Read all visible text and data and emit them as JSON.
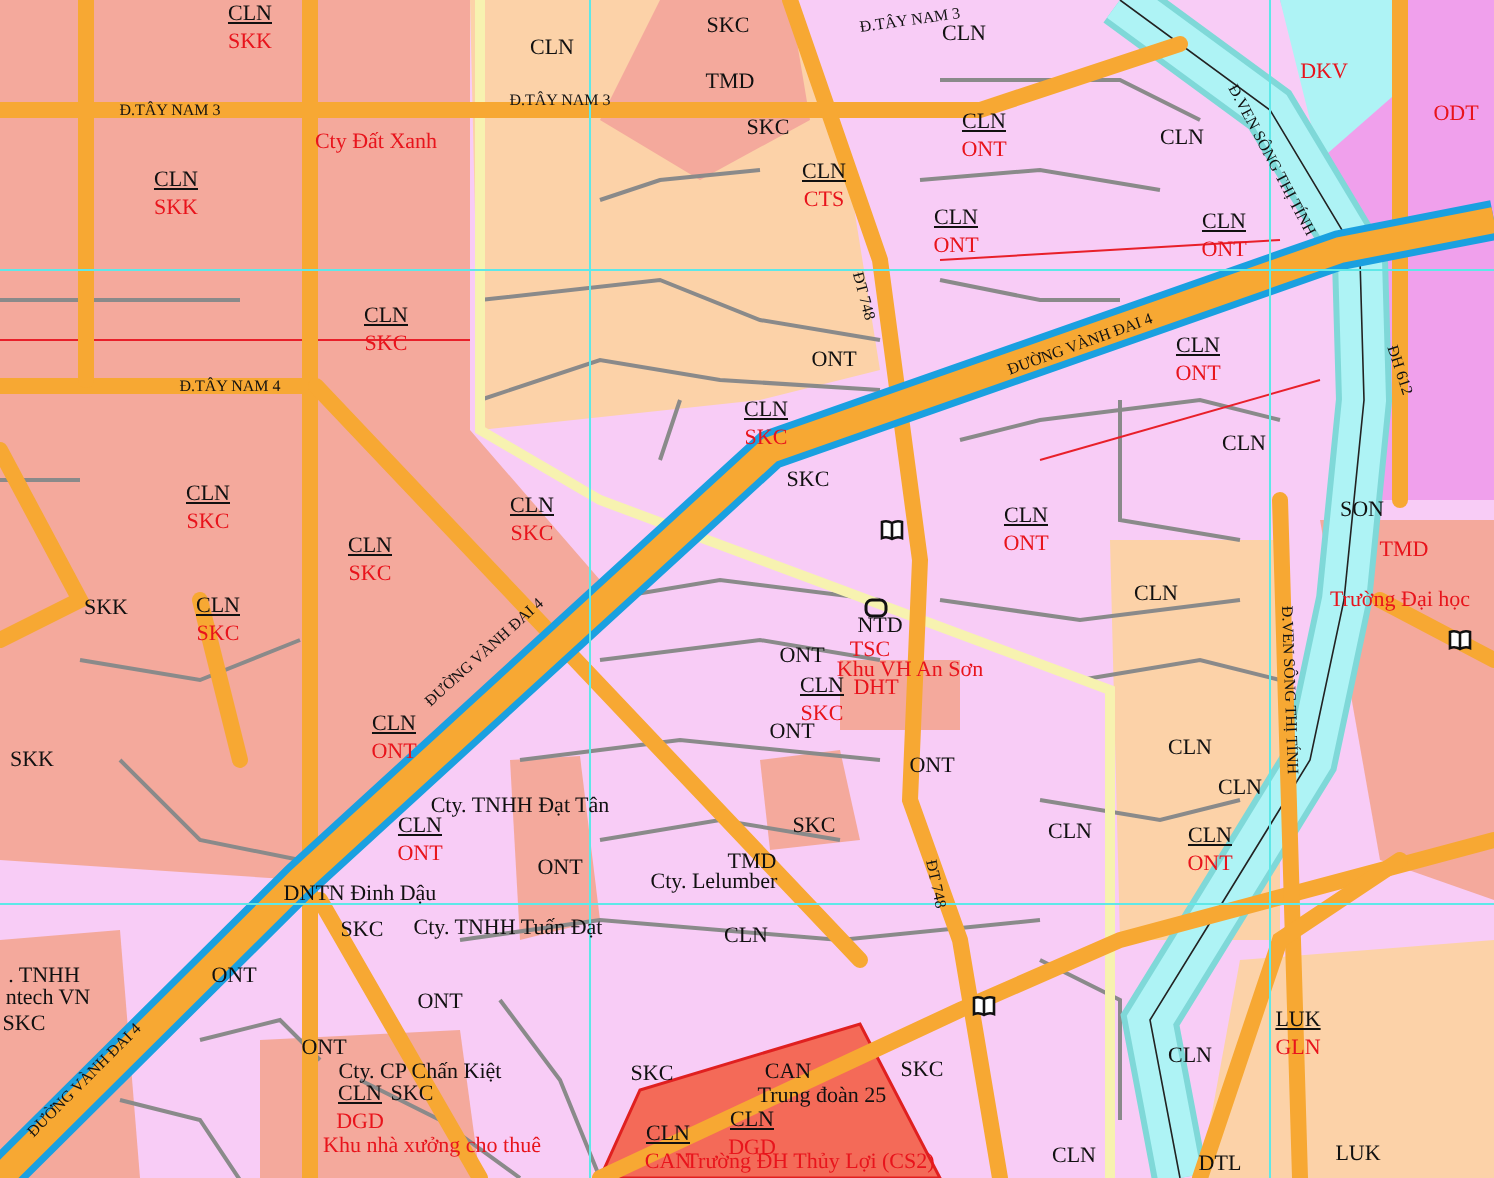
{
  "map": {
    "labels": [
      {
        "kind": "parcel",
        "top": "CLN",
        "bottom": "SKK"
      },
      {
        "kind": "parcel",
        "top": "CLN",
        "bottom": "SKK"
      },
      {
        "kind": "parcel",
        "top": "CLN",
        "bottom": "SKC"
      },
      {
        "kind": "parcel",
        "top": "CLN",
        "bottom": "SKC"
      },
      {
        "kind": "parcel",
        "top": "CLN",
        "bottom": "SKC"
      },
      {
        "kind": "parcel",
        "top": "CLN",
        "bottom": "SKC"
      },
      {
        "kind": "parcel",
        "top": "CLN",
        "bottom": "SKC"
      },
      {
        "kind": "parcel",
        "top": "CLN",
        "bottom": "CTS"
      },
      {
        "kind": "parcel",
        "top": "CLN",
        "bottom": "ONT"
      },
      {
        "kind": "parcel",
        "top": "CLN",
        "bottom": "ONT"
      },
      {
        "kind": "parcel",
        "top": "CLN",
        "bottom": "SKC"
      },
      {
        "kind": "parcel",
        "top": "CLN",
        "bottom": "ONT"
      },
      {
        "kind": "parcel",
        "top": "CLN",
        "bottom": "ONT"
      },
      {
        "kind": "parcel",
        "top": "CLN",
        "bottom": "ONT"
      },
      {
        "kind": "parcel",
        "top": "CLN",
        "bottom": "ONT"
      },
      {
        "kind": "parcel",
        "top": "CLN",
        "bottom": "ONT"
      },
      {
        "kind": "parcel",
        "top": "CLN",
        "bottom": "DGD"
      },
      {
        "kind": "parcel",
        "top": "CLN",
        "bottom": "SKC"
      },
      {
        "kind": "parcel",
        "top": "CLN",
        "bottom": "DGD"
      },
      {
        "kind": "parcel",
        "top": "CLN",
        "bottom": "CAN"
      },
      {
        "kind": "parcel",
        "top": "CLN",
        "bottom": "ONT"
      },
      {
        "kind": "parcel",
        "top": "LUK",
        "bottom": "GLN"
      },
      {
        "kind": "code",
        "text": "SKC"
      },
      {
        "kind": "code",
        "text": "CLN"
      },
      {
        "kind": "code",
        "text": "TMD"
      },
      {
        "kind": "code",
        "text": "SKC"
      },
      {
        "kind": "code",
        "text": "CLN"
      },
      {
        "kind": "code",
        "text": "CLN"
      },
      {
        "kind": "code",
        "text": "ONT"
      },
      {
        "kind": "code",
        "text": "SKC"
      },
      {
        "kind": "code",
        "text": "ONT"
      },
      {
        "kind": "code",
        "text": "ONT"
      },
      {
        "kind": "code",
        "text": "ONT"
      },
      {
        "kind": "code",
        "text": "SKC"
      },
      {
        "kind": "code",
        "text": "TMD"
      },
      {
        "kind": "code",
        "text": "SKC"
      },
      {
        "kind": "code",
        "text": "CLN"
      },
      {
        "kind": "code",
        "text": "ONT"
      },
      {
        "kind": "code",
        "text": "ONT"
      },
      {
        "kind": "code",
        "text": "ONT"
      },
      {
        "kind": "code",
        "text": "SKC"
      },
      {
        "kind": "code",
        "text": "SKC"
      },
      {
        "kind": "code",
        "text": "CAN"
      },
      {
        "kind": "code",
        "text": "SKC"
      },
      {
        "kind": "code",
        "text": "SKK"
      },
      {
        "kind": "code",
        "text": "SKK"
      },
      {
        "kind": "code",
        "text": "ONT"
      },
      {
        "kind": "code",
        "text": "CLN"
      },
      {
        "kind": "code",
        "text": "SON"
      },
      {
        "kind": "code",
        "text": "CLN"
      },
      {
        "kind": "code",
        "text": "CLN"
      },
      {
        "kind": "code",
        "text": "CLN"
      },
      {
        "kind": "code",
        "text": "CLN"
      },
      {
        "kind": "code",
        "text": "CLN"
      },
      {
        "kind": "code",
        "text": "CLN"
      },
      {
        "kind": "code",
        "text": "NTD"
      },
      {
        "kind": "code",
        "text": "SKC"
      },
      {
        "kind": "code",
        "text": "LUK"
      },
      {
        "kind": "code",
        "text": "DTL"
      },
      {
        "kind": "code_red",
        "text": "DKV"
      },
      {
        "kind": "code_red",
        "text": "ODT"
      },
      {
        "kind": "code_red",
        "text": "TMD"
      },
      {
        "kind": "code_red",
        "text": "TSC"
      },
      {
        "kind": "code_red",
        "text": "DHT"
      },
      {
        "kind": "label",
        "text": "Cty. TNHH Đạt Tân"
      },
      {
        "kind": "label",
        "text": "Cty. TNHH Tuấn Đạt"
      },
      {
        "kind": "label",
        "text": "Cty. Lelumber"
      },
      {
        "kind": "label",
        "text": "DNTN Đinh Dậu"
      },
      {
        "kind": "label",
        "text": "Cty. CP Chấn Kiệt"
      },
      {
        "kind": "label",
        "text": "Trung đoàn 25"
      },
      {
        "kind": "label",
        "text": ". TNHH"
      },
      {
        "kind": "label",
        "text": "ntech VN"
      },
      {
        "kind": "label_red",
        "text": "Cty Đất Xanh"
      },
      {
        "kind": "label_red",
        "text": "Khu VH An Sơn"
      },
      {
        "kind": "label_red",
        "text": "Khu nhà xưởng cho thuê"
      },
      {
        "kind": "label_red",
        "text": "Trường Đại học"
      },
      {
        "kind": "label_red",
        "text": "Trường ĐH Thủy Lợi (CS2)"
      },
      {
        "kind": "road",
        "text": "Đ.TÂY NAM 3"
      },
      {
        "kind": "road",
        "text": "Đ.TÂY NAM 3"
      },
      {
        "kind": "road",
        "text": "Đ.TÂY NAM 3"
      },
      {
        "kind": "road",
        "text": "Đ.TÂY NAM 4"
      },
      {
        "kind": "road",
        "text": "ĐƯỜNG VÀNH ĐAI 4"
      },
      {
        "kind": "road",
        "text": "ĐƯỜNG VÀNH ĐAI 4"
      },
      {
        "kind": "road",
        "text": "ĐƯỜNG VÀNH ĐAI 4"
      },
      {
        "kind": "road",
        "text": "ĐT 748"
      },
      {
        "kind": "road",
        "text": "ĐT 748"
      },
      {
        "kind": "road",
        "text": "ĐH 612"
      },
      {
        "kind": "road",
        "text": "Đ.VEN SÔNG THỊ TÍNH"
      },
      {
        "kind": "road",
        "text": "Đ.VEN SÔNG THỊ TÍNH"
      }
    ]
  }
}
